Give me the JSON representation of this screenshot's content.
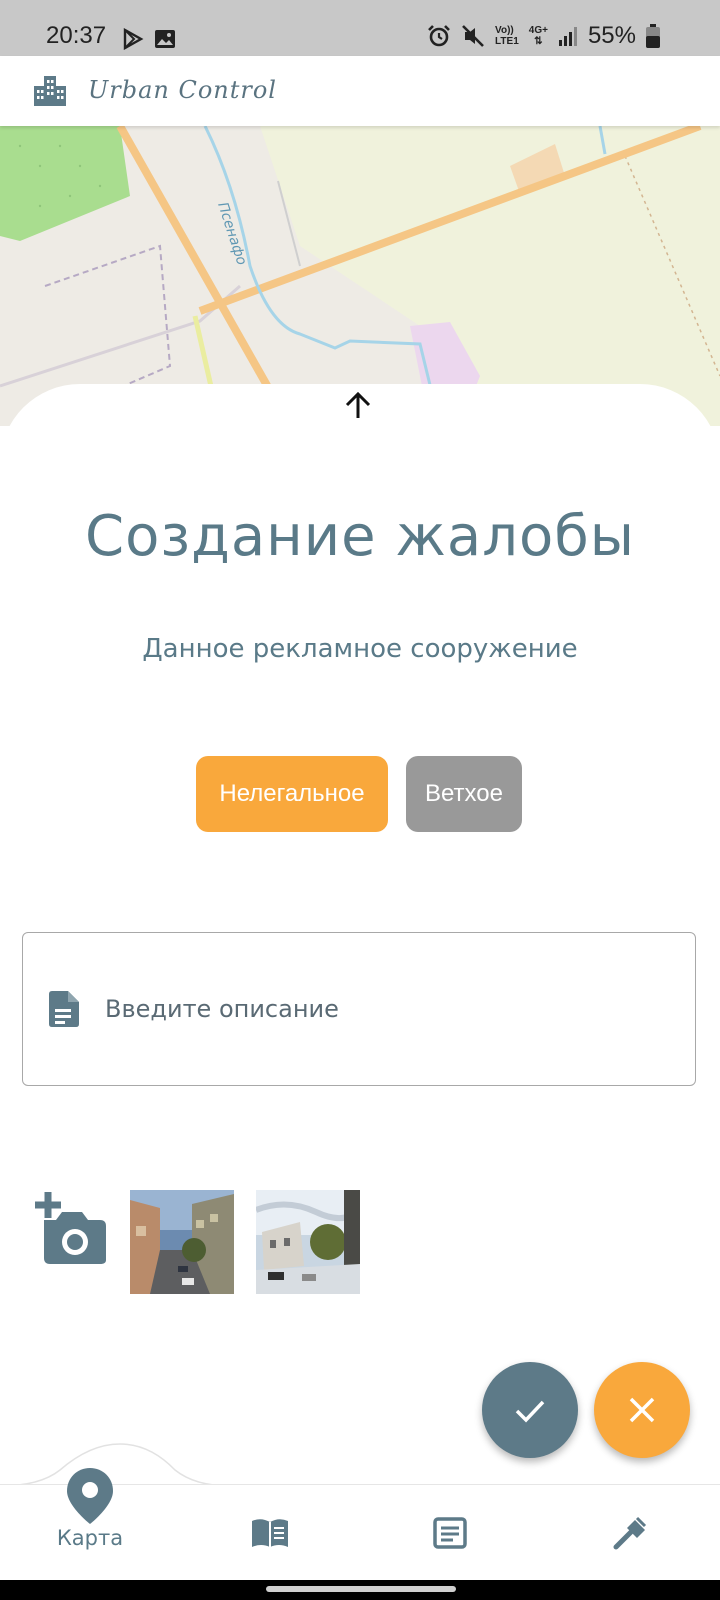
{
  "status_bar": {
    "time": "20:37",
    "network_label_top": "Vo))",
    "network_label_bottom": "LTE1",
    "network_type": "4G+",
    "battery": "55%"
  },
  "app_bar": {
    "title": "Urban Control",
    "logo_icon": "city-buildings-icon"
  },
  "map": {
    "street_label": "Псенафо"
  },
  "sheet": {
    "title": "Создание жалобы",
    "subtitle": "Данное рекламное сооружение",
    "choices": [
      {
        "label": "Нелегальное",
        "selected": true
      },
      {
        "label": "Ветхое",
        "selected": false
      }
    ],
    "description": {
      "placeholder": "Введите описание",
      "value": ""
    },
    "photos_count": 2
  },
  "actions": {
    "confirm_icon": "check-icon",
    "cancel_icon": "close-icon"
  },
  "bottom_nav": {
    "items": [
      {
        "label": "Карта",
        "icon": "map-pin-icon",
        "active": true
      },
      {
        "label": "",
        "icon": "book-icon",
        "active": false
      },
      {
        "label": "",
        "icon": "article-icon",
        "active": false
      },
      {
        "label": "",
        "icon": "hammer-icon",
        "active": false
      }
    ]
  },
  "colors": {
    "accent": "#f9a83c",
    "primary": "#5d7a88",
    "inactive_choice": "#999999"
  }
}
